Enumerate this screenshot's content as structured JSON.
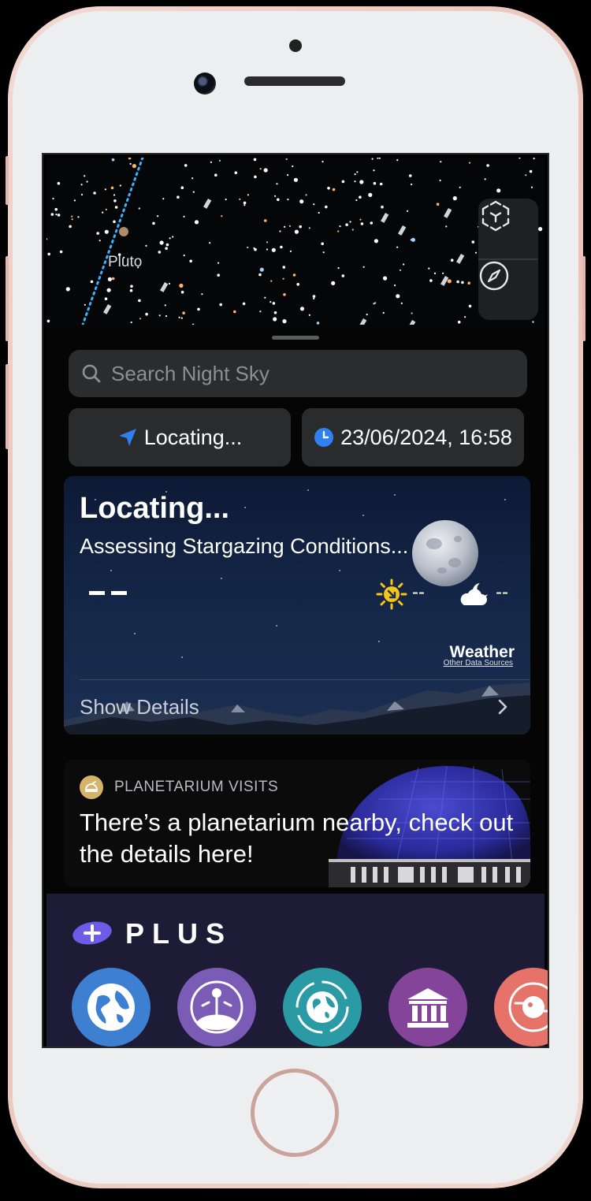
{
  "sky": {
    "object_label": "Pluto",
    "view_mode_icon": "cube-view-icon",
    "compass_icon": "compass-icon"
  },
  "search": {
    "placeholder": "Search Night Sky"
  },
  "location_button": {
    "label": "Locating...",
    "icon": "location-arrow-icon",
    "icon_color": "#2f80f0"
  },
  "datetime_button": {
    "label": "23/06/2024, 16:58",
    "icon": "clock-icon",
    "icon_color": "#2f80f0"
  },
  "conditions_card": {
    "title": "Locating...",
    "subtitle": "Assessing Stargazing Conditions...",
    "day_value": "--",
    "night_value": "--",
    "weather_label": "Weather",
    "data_sources_link": "Other Data Sources",
    "details_label": "Show Details"
  },
  "planetarium_card": {
    "category": "PLANETARIUM VISITS",
    "message": "There’s a planetarium nearby, check out the details here!"
  },
  "plus_section": {
    "title": "PLUS",
    "accent_color": "#6c5ce7",
    "features": [
      {
        "icon": "globe-icon",
        "color": "#3d7fd0"
      },
      {
        "icon": "globe-orbit-icon",
        "color": "#7a5bb5"
      },
      {
        "icon": "globe-rotate-icon",
        "color": "#2a9aa5"
      },
      {
        "icon": "museum-icon",
        "color": "#84449a"
      },
      {
        "icon": "planet-icon",
        "color": "#e57369"
      }
    ]
  }
}
